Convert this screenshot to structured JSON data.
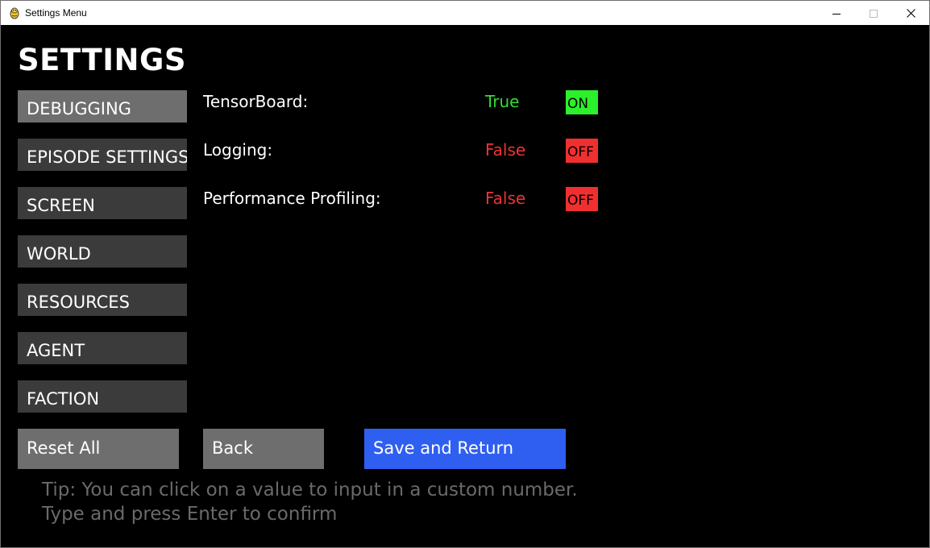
{
  "window": {
    "title": "Settings Menu",
    "app_icon": "pygame-snake-icon",
    "minimize_icon": "minimize-icon",
    "maximize_icon": "maximize-icon",
    "close_icon": "close-icon"
  },
  "page": {
    "heading": "SETTINGS"
  },
  "categories": [
    {
      "label": "DEBUGGING",
      "active": true
    },
    {
      "label": "EPISODE SETTINGS",
      "active": false
    },
    {
      "label": "SCREEN",
      "active": false
    },
    {
      "label": "WORLD",
      "active": false
    },
    {
      "label": "RESOURCES",
      "active": false
    },
    {
      "label": "AGENT",
      "active": false
    },
    {
      "label": "FACTION",
      "active": false
    }
  ],
  "settings": [
    {
      "label": "TensorBoard:",
      "value": "True",
      "toggle": "ON"
    },
    {
      "label": "Logging:",
      "value": "False",
      "toggle": "OFF"
    },
    {
      "label": "Performance Profiling:",
      "value": "False",
      "toggle": "OFF"
    }
  ],
  "actions": {
    "reset": "Reset All",
    "back": "Back",
    "save": "Save and Return"
  },
  "tip": {
    "line1": "Tip: You can click on a value to input in a custom number.",
    "line2": "Type and press Enter to confirm"
  },
  "colors": {
    "true_text": "#33dd33",
    "false_text": "#ee3333",
    "on_bg": "#2cf02c",
    "off_bg": "#f03030",
    "active_tab": "#6e6e6e",
    "inactive_tab": "#3b3b3b",
    "reset_bg": "#6e6e6e",
    "back_bg": "#6e6e6e",
    "save_bg": "#2f5ff0",
    "tip_text": "#6a6a6a"
  }
}
